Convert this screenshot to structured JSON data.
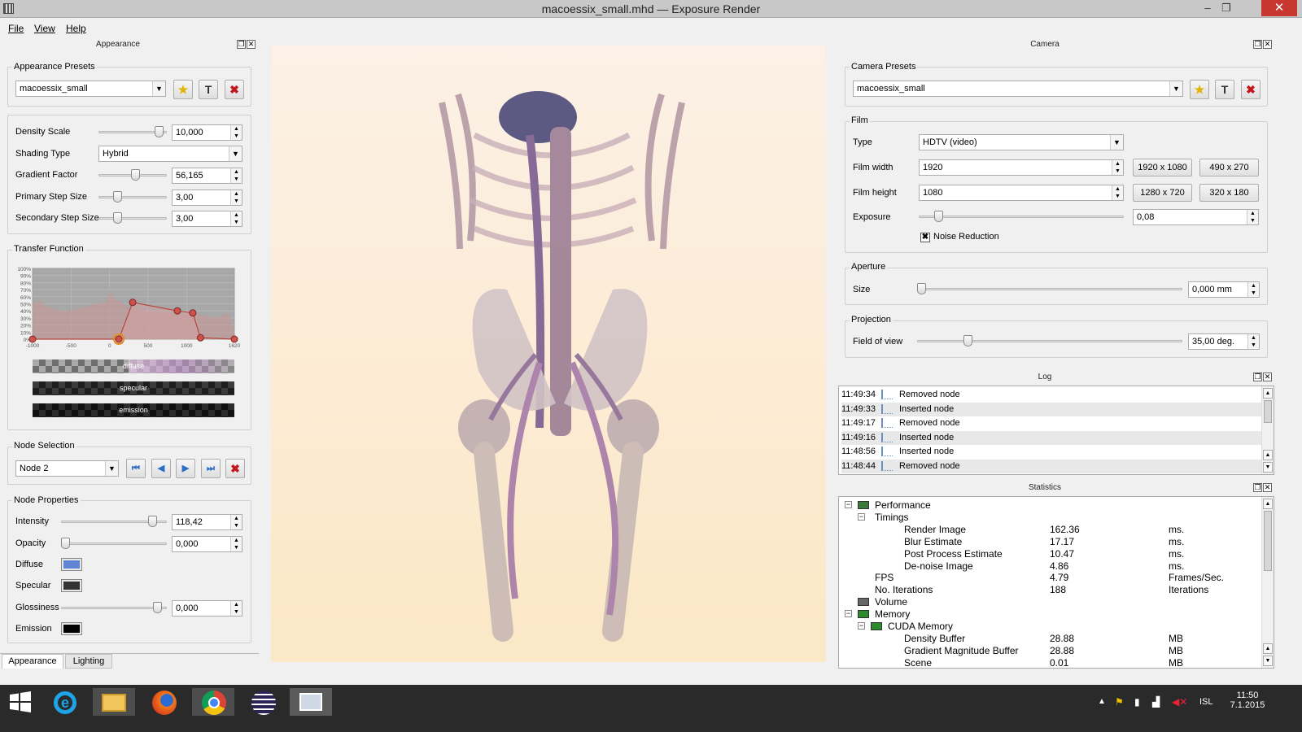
{
  "window": {
    "title": "macoessix_small.mhd — Exposure Render",
    "min": "–",
    "restore": "❐",
    "close": "✕"
  },
  "menu": {
    "items": [
      "File",
      "View",
      "Help"
    ]
  },
  "appearance": {
    "dock_title": "Appearance",
    "presets_label": "Appearance Presets",
    "preset_value": "macoessix_small",
    "density_scale": {
      "label": "Density Scale",
      "value": "10,000",
      "level": 0.95
    },
    "shading_type": {
      "label": "Shading Type",
      "value": "Hybrid"
    },
    "gradient_factor": {
      "label": "Gradient Factor",
      "value": "56,165",
      "level": 0.55
    },
    "primary_step": {
      "label": "Primary Step Size",
      "value": "3,00",
      "level": 0.25
    },
    "secondary_step": {
      "label": "Secondary Step Size",
      "value": "3,00",
      "level": 0.25
    },
    "transfer_function": {
      "label": "Transfer Function",
      "y_ticks": [
        "100%",
        "90%",
        "80%",
        "70%",
        "60%",
        "50%",
        "40%",
        "30%",
        "20%",
        "10%",
        "0%"
      ],
      "x_ticks": [
        "-1000",
        "-500",
        "0",
        "500",
        "1000",
        "1620"
      ],
      "nodes": [
        [
          -1000,
          0
        ],
        [
          120,
          0
        ],
        [
          300,
          0.52
        ],
        [
          880,
          0.4
        ],
        [
          1080,
          0.37
        ],
        [
          1180,
          0.02
        ],
        [
          1620,
          0
        ]
      ],
      "bars": {
        "diffuse": "diffuse",
        "specular": "specular",
        "emission": "emission"
      }
    },
    "node_selection": {
      "label": "Node Selection",
      "value": "Node 2"
    },
    "node_properties": {
      "label": "Node Properties",
      "intensity": {
        "label": "Intensity",
        "value": "118,42",
        "level": 0.9
      },
      "opacity": {
        "label": "Opacity",
        "value": "0,000",
        "level": 0.0
      },
      "diffuse": {
        "label": "Diffuse",
        "color": "#5f84d6"
      },
      "specular": {
        "label": "Specular",
        "color": "#333333"
      },
      "glossiness": {
        "label": "Glossiness",
        "value": "0,000",
        "level": 0.95
      },
      "emission": {
        "label": "Emission",
        "color": "#000000"
      }
    },
    "tabs": [
      "Appearance",
      "Lighting"
    ]
  },
  "camera": {
    "dock_title": "Camera",
    "presets_label": "Camera Presets",
    "preset_value": "macoessix_small",
    "film": {
      "label": "Film",
      "type_label": "Type",
      "type_value": "HDTV (video)",
      "width_label": "Film width",
      "width_value": "1920",
      "height_label": "Film height",
      "height_value": "1080",
      "exposure_label": "Exposure",
      "exposure_value": "0,08",
      "exposure_level": 0.08,
      "noise_label": "Noise Reduction",
      "presets": [
        "1920 x 1080",
        "490 x 270",
        "1280 x 720",
        "320 x 180"
      ]
    },
    "aperture": {
      "label": "Aperture",
      "size_label": "Size",
      "size_value": "0,000 mm",
      "level": 0.0
    },
    "projection": {
      "label": "Projection",
      "fov_label": "Field of view",
      "fov_value": "35,00 deg.",
      "level": 0.18
    }
  },
  "log": {
    "dock_title": "Log",
    "rows": [
      {
        "time": "11:49:34",
        "msg": "Removed node"
      },
      {
        "time": "11:49:33",
        "msg": "Inserted node"
      },
      {
        "time": "11:49:17",
        "msg": "Removed node"
      },
      {
        "time": "11:49:16",
        "msg": "Inserted node"
      },
      {
        "time": "11:48:56",
        "msg": "Inserted node"
      },
      {
        "time": "11:48:44",
        "msg": "Removed node"
      }
    ]
  },
  "statistics": {
    "dock_title": "Statistics",
    "rows": [
      {
        "name": "Performance",
        "value": "",
        "unit": ""
      },
      {
        "name": "Timings",
        "value": "",
        "unit": ""
      },
      {
        "name": "Render Image",
        "value": "162.36",
        "unit": "ms."
      },
      {
        "name": "Blur Estimate",
        "value": "17.17",
        "unit": "ms."
      },
      {
        "name": "Post Process Estimate",
        "value": "10.47",
        "unit": "ms."
      },
      {
        "name": "De-noise Image",
        "value": "4.86",
        "unit": "ms."
      },
      {
        "name": "FPS",
        "value": "4.79",
        "unit": "Frames/Sec."
      },
      {
        "name": "No. Iterations",
        "value": "188",
        "unit": "Iterations"
      },
      {
        "name": "Volume",
        "value": "",
        "unit": ""
      },
      {
        "name": "Memory",
        "value": "",
        "unit": ""
      },
      {
        "name": "CUDA Memory",
        "value": "",
        "unit": ""
      },
      {
        "name": "Density Buffer",
        "value": "28.88",
        "unit": "MB"
      },
      {
        "name": "Gradient Magnitude Buffer",
        "value": "28.88",
        "unit": "MB"
      },
      {
        "name": "Scene",
        "value": "0.01",
        "unit": "MB"
      }
    ]
  },
  "taskbar": {
    "lang": "ISL",
    "time": "11:50",
    "date": "7.1.2015"
  }
}
